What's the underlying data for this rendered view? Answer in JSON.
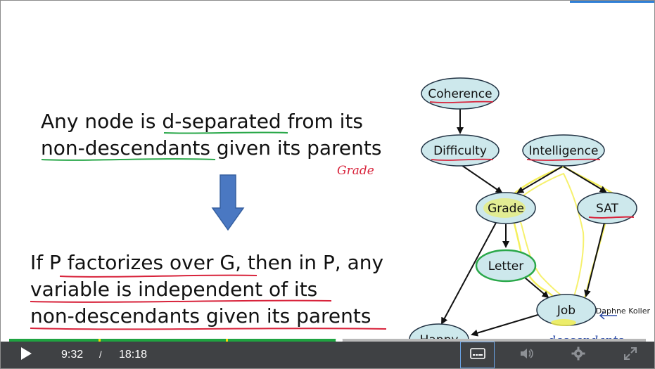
{
  "slide": {
    "statement1": {
      "line1_pre": "Any node is ",
      "line1_u": "d-separated",
      "line1_post": " from its",
      "line2_u": "non-descendants",
      "line2_post": " given its parents"
    },
    "annotation_grade": "Grade",
    "statement2": {
      "line1_pre": "If ",
      "line1_u": "P factorizes over G",
      "line1_post": ", then in P, any",
      "line2": "variable is independent of its",
      "line3": "non-descendants given its parents"
    },
    "graph_nodes": {
      "coherence": "Coherence",
      "difficulty": "Difficulty",
      "intelligence": "Intelligence",
      "grade": "Grade",
      "sat": "SAT",
      "letter": "Letter",
      "job": "Job",
      "happy": "Happy"
    },
    "annotation_descendants": "descendants",
    "credit": "Daphne Koller",
    "colors": {
      "node_fill": "#cde8ec",
      "node_stroke": "#223344",
      "arrow_blue": "#4a78c2",
      "ink_red": "#d8233b",
      "ink_green": "#2aa84a",
      "highlight_yellow": "#f4ee4a",
      "ink_blue": "#2a4aa8"
    }
  },
  "player": {
    "current_time": "9:32",
    "separator": "/",
    "duration": "18:18",
    "progress_fraction": 0.5185,
    "chapter_markers": [
      0.14,
      0.34
    ],
    "icons": {
      "play": "play-icon",
      "captions": "captions-icon",
      "volume": "volume-icon",
      "settings": "gear-icon",
      "fullscreen": "fullscreen-icon"
    },
    "colors": {
      "bar_bg": "#3f4144",
      "progress": "#1fa341",
      "marker": "#f5d90a"
    }
  }
}
